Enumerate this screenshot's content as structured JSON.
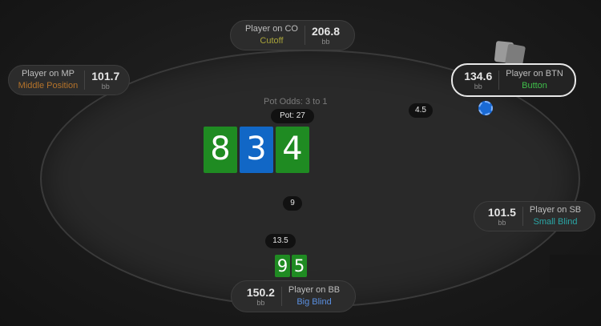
{
  "table": {
    "pot_odds": "Pot Odds: 3 to 1",
    "pot": "Pot: 27",
    "board": [
      {
        "rank": "8",
        "color": "#1f8b22"
      },
      {
        "rank": "3",
        "color": "#1167c6"
      },
      {
        "rank": "4",
        "color": "#1f8b22"
      }
    ],
    "bets": {
      "btn": "4.5",
      "bb_chips_mid": "9",
      "bb_bet": "13.5"
    },
    "hero_cards": [
      {
        "rank": "9",
        "color": "#1f8b22"
      },
      {
        "rank": "5",
        "color": "#1f8b22"
      }
    ]
  },
  "seats": {
    "co": {
      "name": "Player on CO",
      "position": "Cutoff",
      "stack": "206.8",
      "unit": "bb",
      "pos_color": "#a8a33a"
    },
    "mp": {
      "name": "Player on MP",
      "position": "Middle Position",
      "stack": "101.7",
      "unit": "bb",
      "pos_color": "#b5732a"
    },
    "btn": {
      "name": "Player on BTN",
      "position": "Button",
      "stack": "134.6",
      "unit": "bb",
      "pos_color": "#3fbf4a"
    },
    "sb": {
      "name": "Player on SB",
      "position": "Small Blind",
      "stack": "101.5",
      "unit": "bb",
      "pos_color": "#2aa6a6"
    },
    "bb": {
      "name": "Player on BB",
      "position": "Big Blind",
      "stack": "150.2",
      "unit": "bb",
      "pos_color": "#5a8fe0"
    }
  }
}
